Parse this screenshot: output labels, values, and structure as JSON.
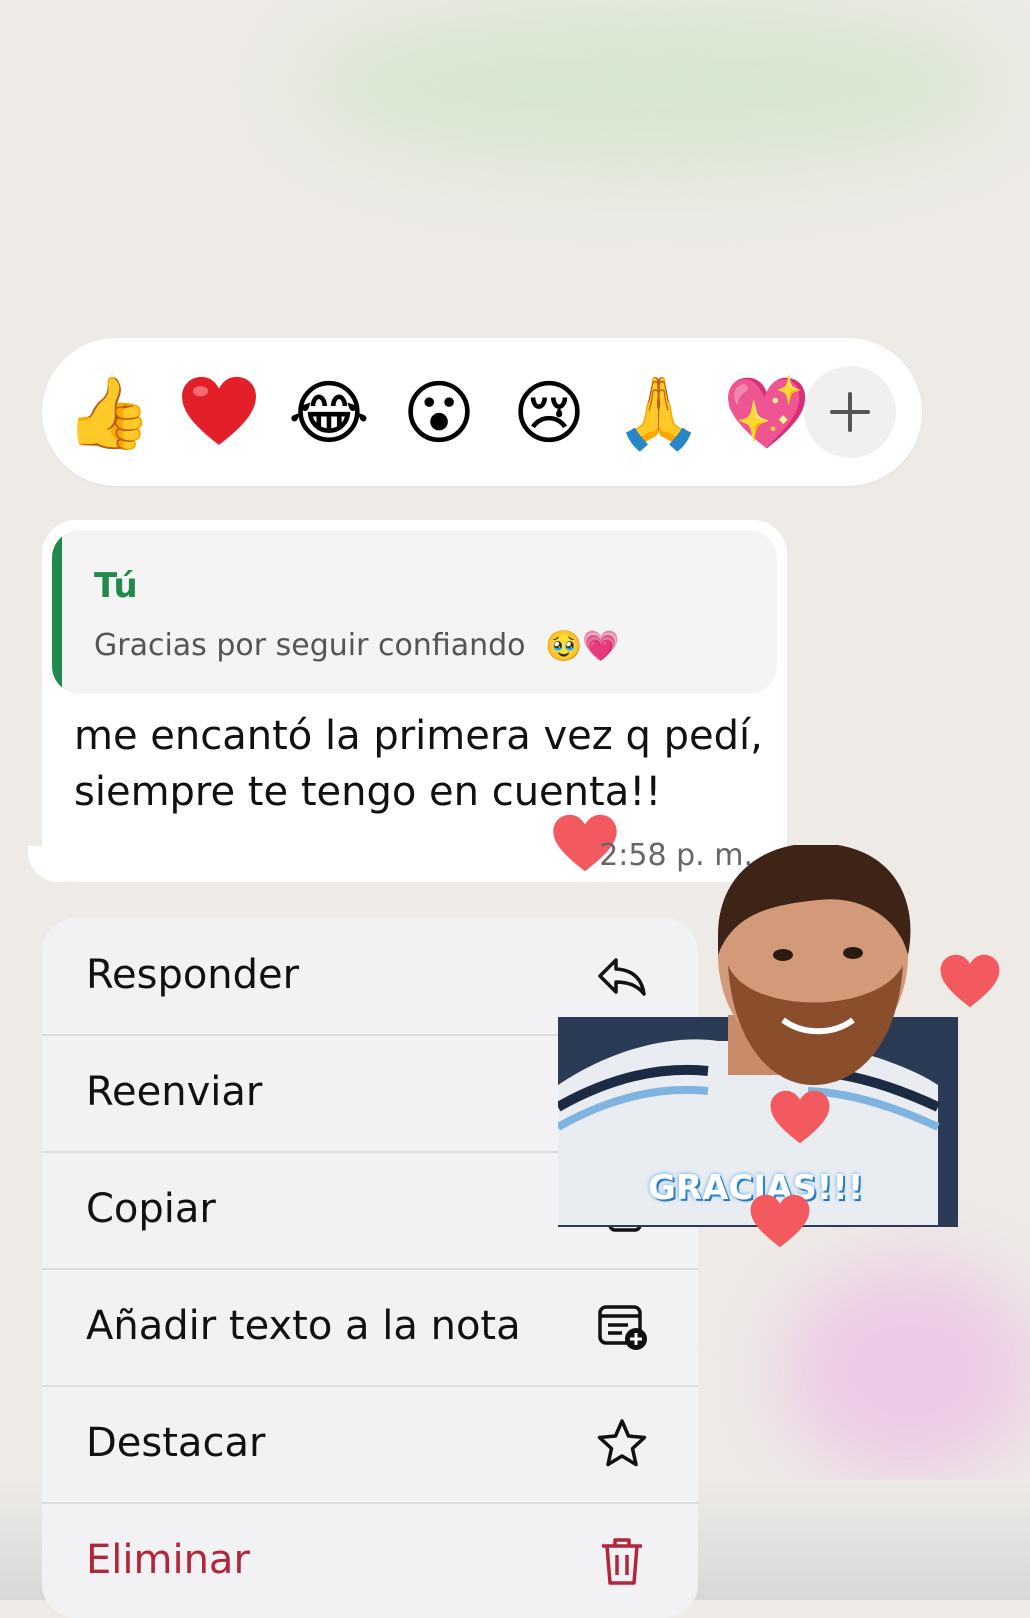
{
  "reactions": {
    "items": [
      {
        "name": "thumbs-up",
        "glyph": "👍"
      },
      {
        "name": "red-heart",
        "glyph": "❤️"
      },
      {
        "name": "tears-of-joy",
        "glyph": "😂"
      },
      {
        "name": "surprised",
        "glyph": "😮"
      },
      {
        "name": "crying",
        "glyph": "😢"
      },
      {
        "name": "folded-hands",
        "glyph": "🙏"
      },
      {
        "name": "sparkling-heart",
        "glyph": "💖"
      }
    ],
    "add_icon": "plus-icon"
  },
  "message": {
    "quote": {
      "author": "Tú",
      "text": "Gracias por seguir confiando",
      "emojis": "🥹💗"
    },
    "text": "me encantó la primera vez q pedí, siempre te tengo en cuenta!!",
    "time": "2:58 p. m."
  },
  "menu": {
    "items": [
      {
        "label": "Responder",
        "icon": "reply-icon"
      },
      {
        "label": "Reenviar",
        "icon": "forward-icon"
      },
      {
        "label": "Copiar",
        "icon": "copy-icon"
      },
      {
        "label": "Añadir texto a la nota",
        "icon": "add-to-note-icon"
      },
      {
        "label": "Destacar",
        "icon": "star-icon"
      },
      {
        "label": "Eliminar",
        "icon": "trash-icon"
      }
    ]
  },
  "sticker": {
    "text": "GRACIAS!!!"
  },
  "colors": {
    "accent_green": "#1f8a4c",
    "danger_red": "#b3263a",
    "heart_pink": "#f25a5f"
  }
}
